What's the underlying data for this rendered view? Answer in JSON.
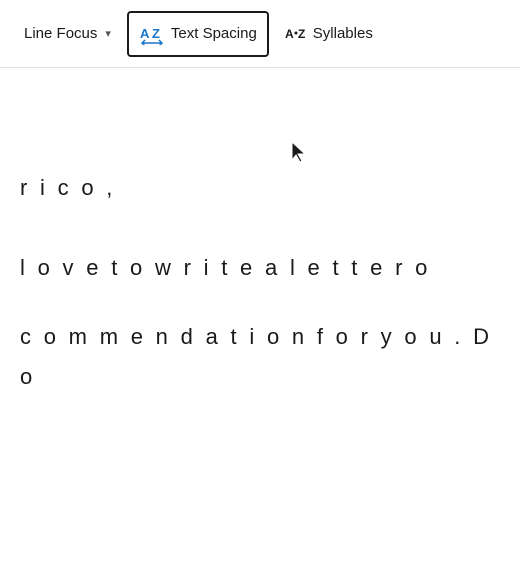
{
  "toolbar": {
    "lineFocus": {
      "label": "Line Focus",
      "hasDropdown": true
    },
    "textSpacing": {
      "label": "Text Spacing",
      "active": true
    },
    "syllables": {
      "label": "Syllables",
      "hasIcon": true
    }
  },
  "content": {
    "line1": "r i c o ,",
    "line2": "  l o v e   t o   w r i t e   a   l e t t e r   o",
    "line3": "c o m m e n d a t i o n   f o r   y o u .   D o"
  }
}
